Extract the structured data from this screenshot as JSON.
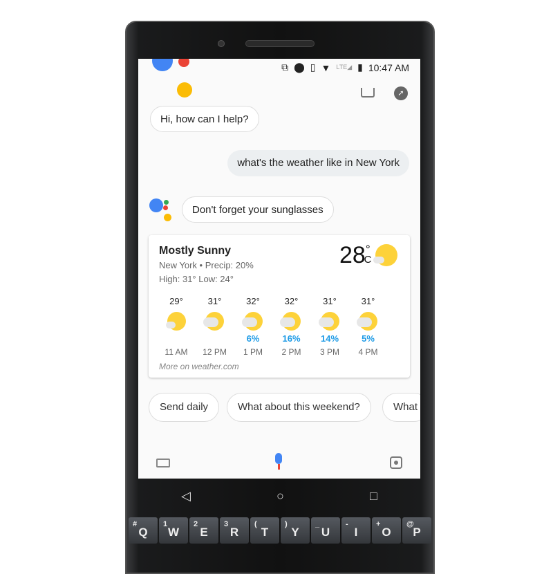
{
  "status": {
    "time": "10:47 AM",
    "network": "LTE",
    "icons": [
      "cast-icon",
      "location-icon",
      "vibrate-icon",
      "wifi-icon",
      "signal-icon",
      "battery-icon"
    ]
  },
  "assistant": {
    "greeting": "Hi, how can I help?",
    "user_query": "what's the weather like in New York",
    "reply": "Don't forget your sunglasses",
    "brand_colors": [
      "#4285f4",
      "#ea4335",
      "#fbbc05",
      "#34a853"
    ]
  },
  "weather": {
    "condition": "Mostly Sunny",
    "location_precip": "New York • Precip: 20%",
    "high_low": "High: 31° Low: 24°",
    "temp": "28",
    "deg": "°",
    "unit": "C",
    "source": "More on weather.com",
    "hours": [
      {
        "temp": "29°",
        "precip": "",
        "time": "11 AM"
      },
      {
        "temp": "31°",
        "precip": "",
        "time": "12 PM"
      },
      {
        "temp": "32°",
        "precip": "6%",
        "time": "1 PM"
      },
      {
        "temp": "32°",
        "precip": "16%",
        "time": "2 PM"
      },
      {
        "temp": "31°",
        "precip": "14%",
        "time": "3 PM"
      },
      {
        "temp": "31°",
        "precip": "5%",
        "time": "4 PM"
      }
    ]
  },
  "chips": [
    "Send daily",
    "What about this weekend?",
    "What"
  ],
  "keyboard": [
    {
      "k": "Q",
      "a": "#"
    },
    {
      "k": "W",
      "a": "1"
    },
    {
      "k": "E",
      "a": "2"
    },
    {
      "k": "R",
      "a": "3"
    },
    {
      "k": "T",
      "a": "("
    },
    {
      "k": "Y",
      "a": ")"
    },
    {
      "k": "U",
      "a": "_"
    },
    {
      "k": "I",
      "a": "-"
    },
    {
      "k": "O",
      "a": "+"
    },
    {
      "k": "P",
      "a": "@"
    }
  ]
}
